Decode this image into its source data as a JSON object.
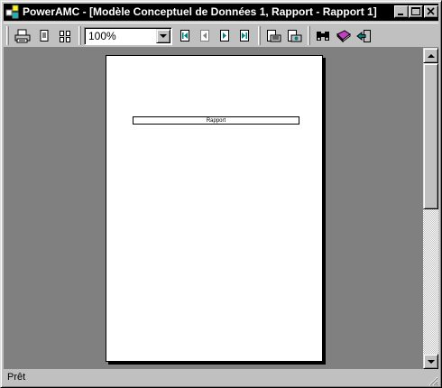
{
  "window": {
    "title": "PowerAMC - [Modèle Conceptuel de Données 1, Rapport - Rapport 1]"
  },
  "titlebar_buttons": [
    "minimize-icon",
    "maximize-icon",
    "close-icon"
  ],
  "toolbar": {
    "buttons": [
      {
        "name": "print-button",
        "icon": "printer-icon"
      },
      {
        "name": "one-page-button",
        "icon": "single-page-icon"
      },
      {
        "name": "two-pages-button",
        "icon": "multi-page-icon"
      },
      {
        "name": "first-page-button",
        "icon": "first-page-icon"
      },
      {
        "name": "previous-page-button",
        "icon": "previous-page-icon"
      },
      {
        "name": "next-page-button",
        "icon": "next-page-icon"
      },
      {
        "name": "last-page-button",
        "icon": "last-page-icon"
      },
      {
        "name": "export-rtf-button",
        "icon": "rtf-icon"
      },
      {
        "name": "export-html-button",
        "icon": "html-icon"
      },
      {
        "name": "find-button",
        "icon": "binoculars-icon"
      },
      {
        "name": "help-button",
        "icon": "help-book-icon"
      },
      {
        "name": "close-preview-button",
        "icon": "exit-door-icon"
      }
    ],
    "zoom_value": "100%"
  },
  "page": {
    "report_title": "Rapport"
  },
  "status": {
    "text": "Prêt"
  },
  "colors": {
    "titlebar": "#000000",
    "face": "#c0c0c0",
    "preview_bg": "#808080",
    "page": "#ffffff",
    "nav_accent": "#008080"
  }
}
